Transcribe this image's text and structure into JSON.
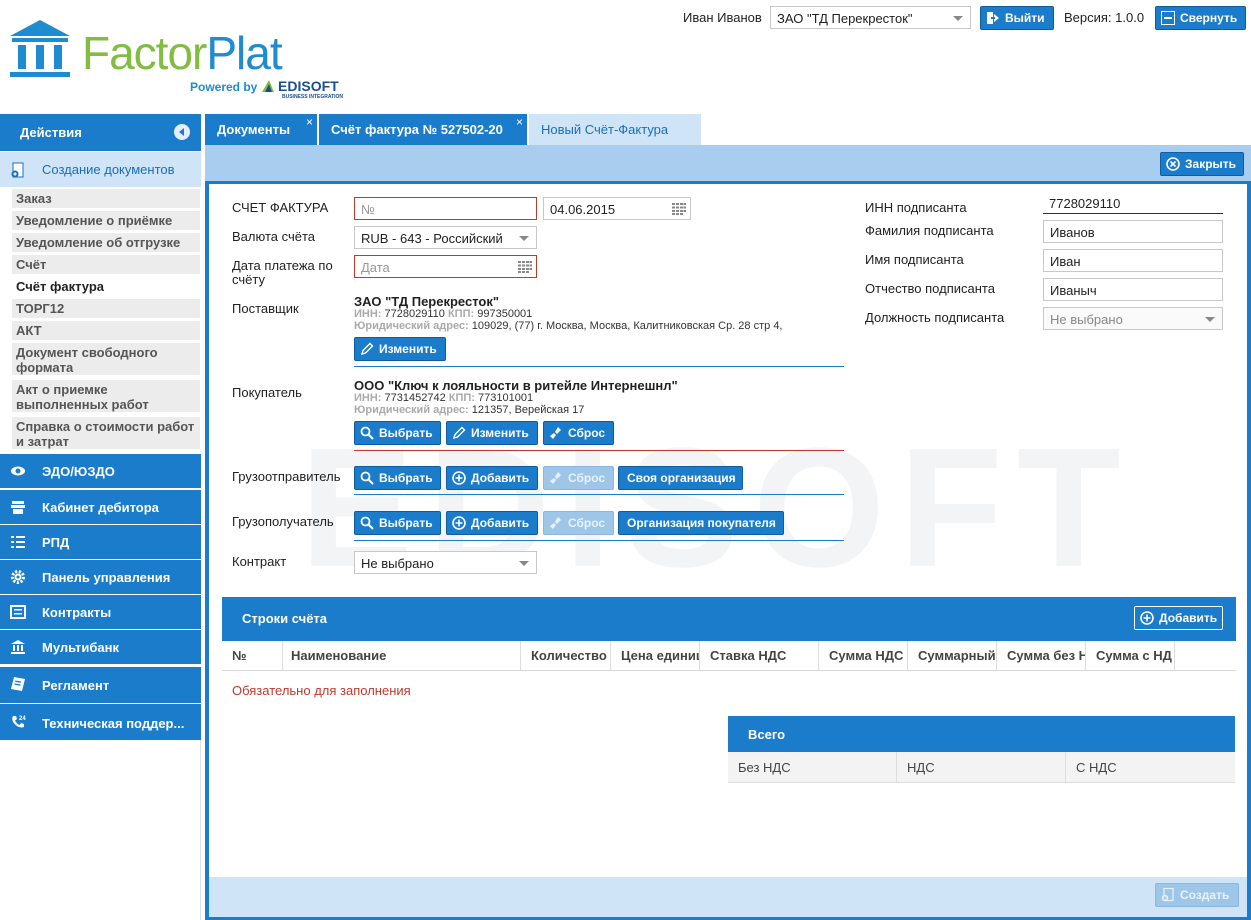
{
  "brand": {
    "name_part1": "Factor",
    "name_part2": "Plat",
    "powered_by": "Powered by",
    "partner": "EDISOFT",
    "partner_sub": "BUSINESS INTEGRATION",
    "watermark": "EDISOFT"
  },
  "header": {
    "user_name": "Иван Иванов",
    "org_select": "ЗАО \"ТД Перекресток\"",
    "logout_label": "Выйти",
    "version": "Версия: 1.0.0",
    "collapse_label": "Свернуть"
  },
  "sidebar": {
    "title": "Действия",
    "section": "Создание документов",
    "items": [
      {
        "label": "Заказ"
      },
      {
        "label": "Уведомление о приёмке"
      },
      {
        "label": "Уведомление об отгрузке"
      },
      {
        "label": "Счёт"
      },
      {
        "label": "Счёт фактура"
      },
      {
        "label": "ТОРГ12"
      },
      {
        "label": "АКТ"
      },
      {
        "label": "Документ свободного формата"
      },
      {
        "label": "Акт о приемке выполненных работ"
      },
      {
        "label": "Справка о стоимости работ и затрат"
      }
    ],
    "nav": [
      {
        "label": "ЭДО/ЮЗДО",
        "icon": "eye-icon"
      },
      {
        "label": "Кабинет дебитора",
        "icon": "cabinet-icon"
      },
      {
        "label": "РПД",
        "icon": "list-icon"
      },
      {
        "label": "Панель управления",
        "icon": "gear-icon"
      },
      {
        "label": "Контракты",
        "icon": "contracts-icon"
      },
      {
        "label": "Мультибанк",
        "icon": "bank-icon"
      },
      {
        "label": "Регламент",
        "icon": "document-icon"
      },
      {
        "label": "Техническая поддер...",
        "icon": "phone-24-icon"
      }
    ]
  },
  "tabs": [
    {
      "label": "Документы",
      "close": "×"
    },
    {
      "label": "Счёт фактура № 527502-20",
      "close": "×"
    },
    {
      "label": "Новый Счёт-Фактура"
    }
  ],
  "toolbar": {
    "close_label": "Закрыть"
  },
  "form": {
    "invoice_label": "СЧЕТ ФАКТУРА",
    "number_placeholder": "№",
    "date_value": "04.06.2015",
    "currency_label": "Валюта счёта",
    "currency_value": "RUB - 643 - Российский",
    "pay_date_label": "Дата платежа по счёту",
    "pay_date_placeholder": "Дата",
    "supplier_label": "Поставщик",
    "supplier": {
      "name": "ЗАО \"ТД Перекресток\"",
      "inn_key": "ИНН:",
      "inn": "7728029110",
      "kpp_key": "КПП:",
      "kpp": "997350001",
      "addr_key": "Юридический адрес:",
      "addr": "109029, (77) г. Москва, Москва, Калитниковская Ср. 28 стр 4,"
    },
    "buyer_label": "Покупатель",
    "buyer": {
      "name": "ООО \"Ключ к лояльности в ритейле Интернешнл\"",
      "inn_key": "ИНН:",
      "inn": "7731452742",
      "kpp_key": "КПП:",
      "kpp": "773101001",
      "addr_key": "Юридический адрес:",
      "addr": "121357, Верейская 17"
    },
    "shipper_label": "Грузоотправитель",
    "consignee_label": "Грузополучатель",
    "contract_label": "Контракт",
    "contract_value": "Не выбрано",
    "buttons": {
      "change": "Изменить",
      "select": "Выбрать",
      "reset": "Сброс",
      "add": "Добавить",
      "own_org": "Своя организация",
      "buyer_org": "Организация покупателя"
    },
    "signer": {
      "inn_label": "ИНН подписанта",
      "inn_value": "7728029110",
      "last_label": "Фамилия подписанта",
      "last_value": "Иванов",
      "first_label": "Имя подписанта",
      "first_value": "Иван",
      "middle_label": "Отчество подписанта",
      "middle_value": "Иваныч",
      "position_label": "Должность подписанта",
      "position_value": "Не выбрано"
    }
  },
  "lines": {
    "title": "Строки счёта",
    "add_label": "Добавить",
    "columns": [
      "№",
      "Наименование",
      "Количество",
      "Цена единиц",
      "Ставка НДС",
      "Сумма НДС",
      "Суммарный",
      "Сумма без Н",
      "Сумма с НД"
    ],
    "required_note": "Обязательно для заполнения"
  },
  "totals": {
    "title": "Всего",
    "columns": [
      "Без НДС",
      "НДС",
      "С НДС"
    ]
  },
  "footer": {
    "create_label": "Создать"
  },
  "colors": {
    "accent": "#1b7ccc",
    "light": "#cfe4f6",
    "brand_green": "#82bd3f",
    "required": "#c0392b"
  }
}
